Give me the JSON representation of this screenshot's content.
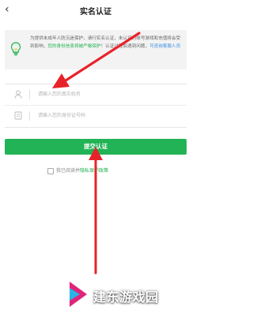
{
  "header": {
    "back_icon": "chevron-left-icon",
    "title": "实名认证"
  },
  "notice": {
    "icon": "lightbulb-icon",
    "text_part1": "为提供未成年人防沉迷保护，请",
    "text_part2": "行实名认证，未认证的账号游戏和充值将会受到影响，",
    "text_green": "您的身份信息将被严格保护",
    "text_part3": "！认证过程如遇到问题，",
    "text_link": "可咨询客服人员"
  },
  "form": {
    "name_placeholder": "请输入您的真实姓名",
    "id_placeholder": "请输入您的身份证号码",
    "name_icon": "user-icon",
    "id_icon": "id-card-icon"
  },
  "submit": {
    "label": "提交认证"
  },
  "agreement": {
    "prefix": "我已阅读并",
    "policy": "隐私保护政策"
  },
  "watermark": {
    "text": "建东游戏园"
  },
  "colors": {
    "accent": "#21b355",
    "link": "#3a8de0",
    "arrow": "#e8222a"
  }
}
